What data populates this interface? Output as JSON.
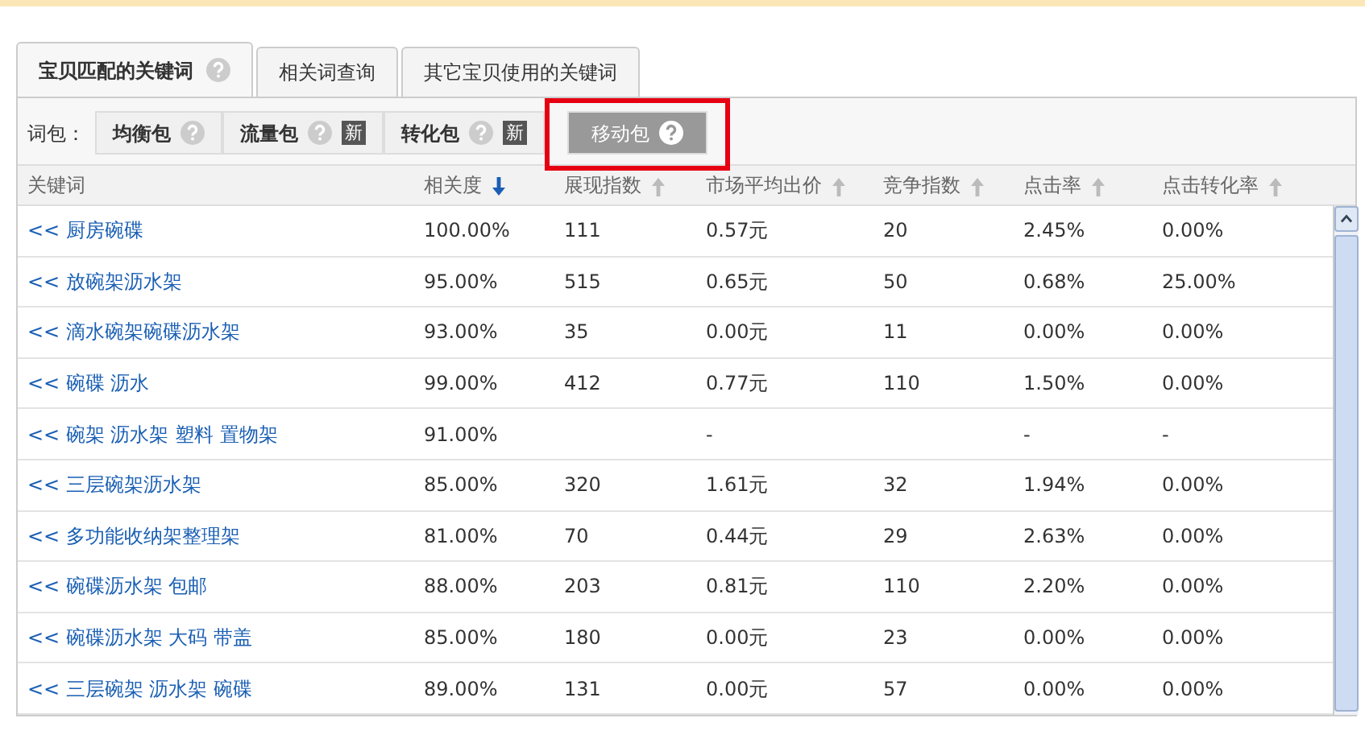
{
  "tabs": [
    {
      "label": "宝贝匹配的关键词",
      "help": true,
      "selected": true
    },
    {
      "label": "相关词查询",
      "help": false,
      "selected": false
    },
    {
      "label": "其它宝贝使用的关键词",
      "help": false,
      "selected": false
    }
  ],
  "packages": {
    "label": "词包：",
    "items": [
      {
        "label": "均衡包",
        "selected": false,
        "highlighted": false
      },
      {
        "label": "流量包",
        "new_badge": "新",
        "selected": false,
        "highlighted": false
      },
      {
        "label": "转化包",
        "new_badge": "新",
        "selected": false,
        "highlighted": false
      },
      {
        "label": "移动包",
        "selected": true,
        "highlighted": true
      }
    ]
  },
  "table": {
    "columns": [
      {
        "label": "关键词"
      },
      {
        "label": "相关度",
        "sort_descending": true
      },
      {
        "label": "展现指数",
        "sort_descending": false
      },
      {
        "label": "市场平均出价",
        "sort_descending": false
      },
      {
        "label": "竞争指数",
        "sort_descending": false
      },
      {
        "label": "点击率",
        "sort_descending": false
      },
      {
        "label": "点击转化率",
        "sort_descending": false
      }
    ],
    "rows": [
      {
        "cells": [
          "<< 厨房碗碟",
          "100.00%",
          "111",
          "0.57元",
          "20",
          "2.45%",
          "0.00%"
        ]
      },
      {
        "cells": [
          "<< 放碗架沥水架",
          "95.00%",
          "515",
          "0.65元",
          "50",
          "0.68%",
          "25.00%"
        ]
      },
      {
        "cells": [
          "<< 滴水碗架碗碟沥水架",
          "93.00%",
          "35",
          "0.00元",
          "11",
          "0.00%",
          "0.00%"
        ]
      },
      {
        "cells": [
          "<< 碗碟 沥水",
          "99.00%",
          "412",
          "0.77元",
          "110",
          "1.50%",
          "0.00%"
        ]
      },
      {
        "cells": [
          "<< 碗架 沥水架 塑料 置物架",
          "91.00%",
          "",
          "-",
          "",
          "-",
          "-"
        ]
      },
      {
        "cells": [
          "<< 三层碗架沥水架",
          "85.00%",
          "320",
          "1.61元",
          "32",
          "1.94%",
          "0.00%"
        ]
      },
      {
        "cells": [
          "<< 多功能收纳架整理架",
          "81.00%",
          "70",
          "0.44元",
          "29",
          "2.63%",
          "0.00%"
        ]
      },
      {
        "cells": [
          "<< 碗碟沥水架 包邮",
          "88.00%",
          "203",
          "0.81元",
          "110",
          "2.20%",
          "0.00%"
        ]
      },
      {
        "cells": [
          "<< 碗碟沥水架 大码 带盖",
          "85.00%",
          "180",
          "0.00元",
          "23",
          "0.00%",
          "0.00%"
        ]
      },
      {
        "cells": [
          "<< 三层碗架 沥水架 碗碟",
          "89.00%",
          "131",
          "0.00元",
          "57",
          "0.00%",
          "0.00%"
        ]
      }
    ]
  }
}
